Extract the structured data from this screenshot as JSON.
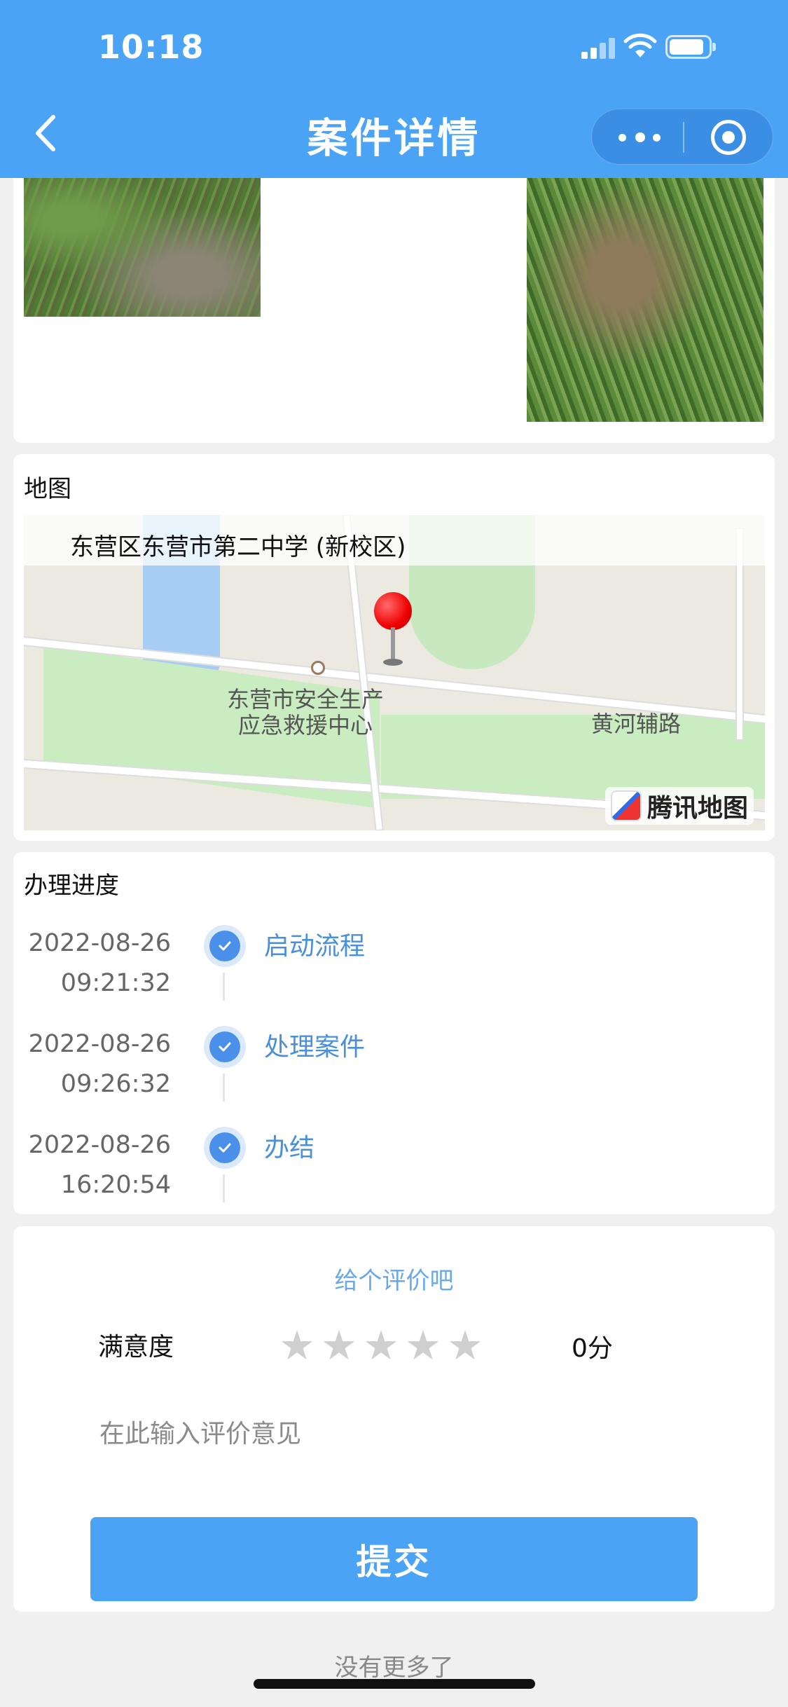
{
  "status_bar": {
    "time": "10:18"
  },
  "nav": {
    "title": "案件详情",
    "back_icon": "chevron-left-icon",
    "more_icon": "more-dots-icon",
    "close_icon": "target-close-icon"
  },
  "colors": {
    "brand": "#4aa3f5",
    "timeline_check": "#4a8fe8",
    "link_text": "#4a90d9"
  },
  "map_section": {
    "title": "地图",
    "location": "东营区东营市第二中学 (新校区)",
    "poi_label": "东营市安全生产\n应急救援中心",
    "road_label": "黄河辅路",
    "provider": "腾讯地图"
  },
  "progress": {
    "title": "办理进度",
    "steps": [
      {
        "date": "2022-08-26",
        "time": "09:21:32",
        "label": "启动流程"
      },
      {
        "date": "2022-08-26",
        "time": "09:26:32",
        "label": "处理案件"
      },
      {
        "date": "2022-08-26",
        "time": "16:20:54",
        "label": "办结"
      }
    ]
  },
  "rating": {
    "prompt": "给个评价吧",
    "label": "满意度",
    "stars_total": 5,
    "stars_selected": 0,
    "score": "0分",
    "comment_placeholder": "在此输入评价意见",
    "submit_label": "提交"
  },
  "footer": {
    "no_more": "没有更多了"
  }
}
